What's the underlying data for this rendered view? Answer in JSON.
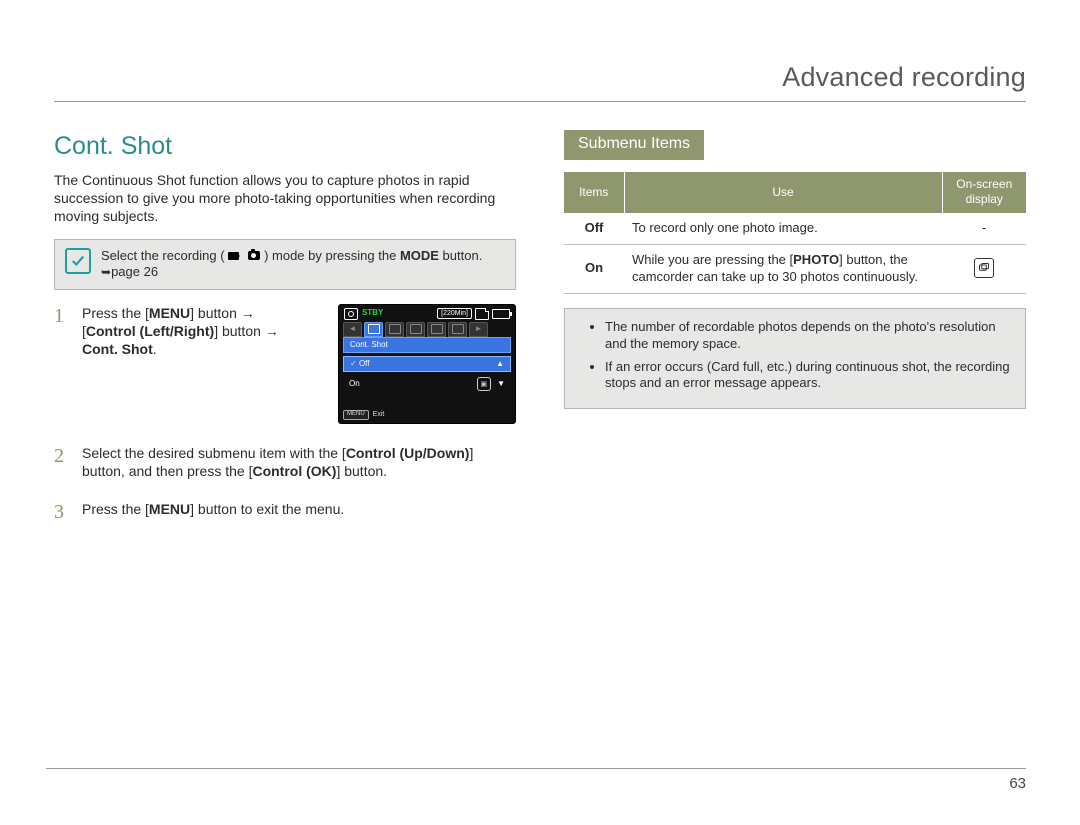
{
  "header": {
    "title": "Advanced recording"
  },
  "left": {
    "title": "Cont. Shot",
    "intro": "The Continuous Shot function allows you to capture photos in rapid succession to give you more photo-taking opportunities when recording moving subjects.",
    "precheck": {
      "pre": "Select the recording (",
      "mid": ") mode by pressing the ",
      "mode": "MODE",
      "post": " button. ",
      "pageref": "page 26"
    },
    "steps": {
      "s1_a": "Press the [",
      "s1_menu": "MENU",
      "s1_b": "] button ",
      "s1_c": "[",
      "s1_ctrl": "Control (Left/Right)",
      "s1_d": "] button ",
      "s1_target": "Cont. Shot",
      "s2_a": "Select the desired submenu item with the [",
      "s2_ctrl": "Control (Up/Down)",
      "s2_b": "] button, and then press the [",
      "s2_ok": "Control (OK)",
      "s2_c": "] button.",
      "s3_a": "Press the [",
      "s3_menu": "MENU",
      "s3_b": "] button to exit the menu."
    },
    "lcd": {
      "stby": "STBY",
      "time": "[220Min]",
      "menu_title": "Cont. Shot",
      "opt_off": "Off",
      "opt_on": "On",
      "exit_key": "MENU",
      "exit_label": "Exit"
    }
  },
  "right": {
    "subhdr": "Submenu Items",
    "cols": {
      "c1": "Items",
      "c2": "Use",
      "c3": "On-screen display"
    },
    "rows": {
      "off": {
        "item": "Off",
        "use": "To record only one photo image.",
        "osd": "-"
      },
      "on": {
        "item": "On",
        "use_a": "While you are pressing the [",
        "use_photo": "PHOTO",
        "use_b": "] button, the camcorder can take up to 30 photos continuously."
      }
    },
    "notes": {
      "n1": "The number of recordable photos depends on the photo's resolution and the memory space.",
      "n2": "If an error occurs (Card full, etc.) during continuous shot, the recording stops and an error message appears."
    }
  },
  "page": "63"
}
